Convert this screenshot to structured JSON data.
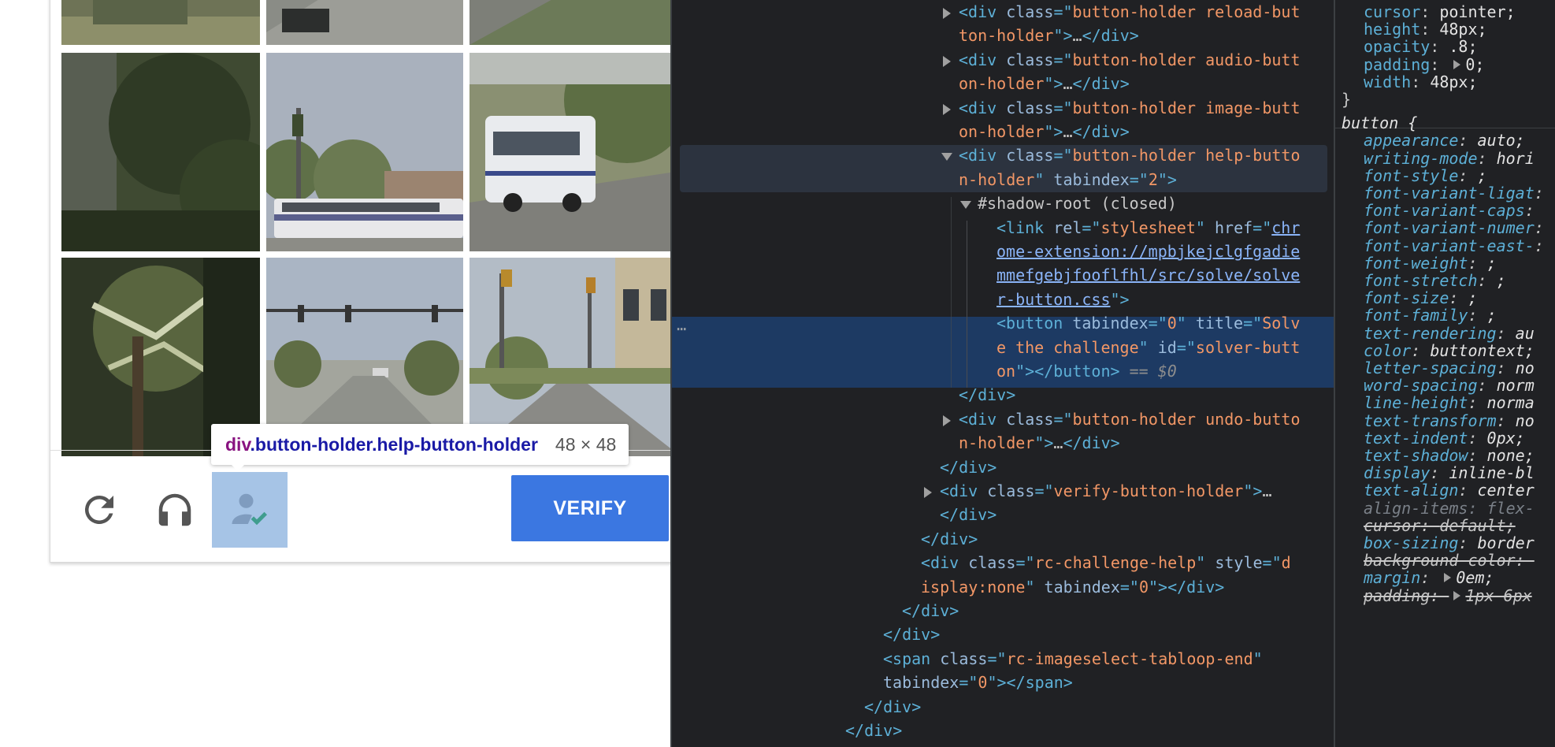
{
  "captcha": {
    "verify_label": "VERIFY",
    "tooltip": {
      "tag": "div",
      "classes": ".button-holder.help-button-holder",
      "size": "48 × 48"
    },
    "icons": {
      "reload": "reload-icon",
      "audio": "headphones-icon",
      "help": "person-check-icon"
    },
    "colors": {
      "verify_bg": "#3b77e1",
      "highlight": "#6fa0d7"
    }
  },
  "dom_tree": {
    "rows": [
      {
        "indent": 0,
        "toggle": "closed",
        "parts": [
          [
            "tag",
            "<div "
          ],
          [
            "attr",
            "class"
          ],
          [
            "tag",
            "=\""
          ],
          [
            "val",
            "button-holder reload-but"
          ]
        ]
      },
      {
        "indent": 0,
        "toggle": null,
        "parts": [
          [
            "val",
            "ton-holder"
          ],
          [
            "tag",
            "\">"
          ],
          [
            "text",
            "…"
          ],
          [
            "tag",
            "</div>"
          ]
        ]
      },
      {
        "indent": 0,
        "toggle": "closed",
        "parts": [
          [
            "tag",
            "<div "
          ],
          [
            "attr",
            "class"
          ],
          [
            "tag",
            "=\""
          ],
          [
            "val",
            "button-holder audio-butt"
          ]
        ]
      },
      {
        "indent": 0,
        "toggle": null,
        "parts": [
          [
            "val",
            "on-holder"
          ],
          [
            "tag",
            "\">"
          ],
          [
            "text",
            "…"
          ],
          [
            "tag",
            "</div>"
          ]
        ]
      },
      {
        "indent": 0,
        "toggle": "closed",
        "parts": [
          [
            "tag",
            "<div "
          ],
          [
            "attr",
            "class"
          ],
          [
            "tag",
            "=\""
          ],
          [
            "val",
            "button-holder image-butt"
          ]
        ]
      },
      {
        "indent": 0,
        "toggle": null,
        "parts": [
          [
            "val",
            "on-holder"
          ],
          [
            "tag",
            "\">"
          ],
          [
            "text",
            "…"
          ],
          [
            "tag",
            "</div>"
          ]
        ]
      },
      {
        "indent": 0,
        "toggle": "open",
        "parts": [
          [
            "tag",
            "<div "
          ],
          [
            "attr",
            "class"
          ],
          [
            "tag",
            "=\""
          ],
          [
            "val",
            "button-holder help-butto"
          ]
        ]
      },
      {
        "indent": 0,
        "toggle": null,
        "parts": [
          [
            "val",
            "n-holder"
          ],
          [
            "tag",
            "\" "
          ],
          [
            "attr",
            "tabindex"
          ],
          [
            "tag",
            "=\""
          ],
          [
            "val",
            "2"
          ],
          [
            "tag",
            "\">"
          ]
        ]
      },
      {
        "indent": 1,
        "toggle": "open",
        "parts": [
          [
            "text",
            "#shadow-root (closed)"
          ]
        ]
      },
      {
        "indent": 2,
        "toggle": null,
        "parts": [
          [
            "tag",
            "<link "
          ],
          [
            "attr",
            "rel"
          ],
          [
            "tag",
            "=\""
          ],
          [
            "val",
            "stylesheet"
          ],
          [
            "tag",
            "\" "
          ],
          [
            "attr",
            "href"
          ],
          [
            "tag",
            "=\""
          ],
          [
            "link",
            "chr"
          ]
        ]
      },
      {
        "indent": 2,
        "toggle": null,
        "parts": [
          [
            "link",
            "ome-extension://mpbjkejclgfgadie"
          ]
        ]
      },
      {
        "indent": 2,
        "toggle": null,
        "parts": [
          [
            "link",
            "mmefgebjfooflfhl/src/solve/solve"
          ]
        ]
      },
      {
        "indent": 2,
        "toggle": null,
        "parts": [
          [
            "link",
            "r-button.css"
          ],
          [
            "tag",
            "\">"
          ]
        ]
      },
      {
        "indent": 2,
        "toggle": null,
        "parts": [
          [
            "tag",
            "<button "
          ],
          [
            "attr",
            "tabindex"
          ],
          [
            "tag",
            "=\""
          ],
          [
            "val",
            "0"
          ],
          [
            "tag",
            "\" "
          ],
          [
            "attr",
            "title"
          ],
          [
            "tag",
            "=\""
          ],
          [
            "val",
            "Solv"
          ]
        ]
      },
      {
        "indent": 2,
        "toggle": null,
        "parts": [
          [
            "val",
            "e the challenge"
          ],
          [
            "tag",
            "\" "
          ],
          [
            "attr",
            "id"
          ],
          [
            "tag",
            "=\""
          ],
          [
            "val",
            "solver-butt"
          ]
        ]
      },
      {
        "indent": 2,
        "toggle": null,
        "parts": [
          [
            "val",
            "on"
          ],
          [
            "tag",
            "\"></button>"
          ],
          [
            "dim",
            " == $0"
          ]
        ]
      },
      {
        "indent": 0,
        "toggle": null,
        "parts": [
          [
            "tag",
            "</div>"
          ]
        ]
      },
      {
        "indent": 0,
        "toggle": "closed",
        "parts": [
          [
            "tag",
            "<div "
          ],
          [
            "attr",
            "class"
          ],
          [
            "tag",
            "=\""
          ],
          [
            "val",
            "button-holder undo-butto"
          ]
        ]
      },
      {
        "indent": 0,
        "toggle": null,
        "parts": [
          [
            "val",
            "n-holder"
          ],
          [
            "tag",
            "\">"
          ],
          [
            "text",
            "…"
          ],
          [
            "tag",
            "</div>"
          ]
        ]
      },
      {
        "indent": -1,
        "toggle": null,
        "parts": [
          [
            "tag",
            "</div>"
          ]
        ]
      },
      {
        "indent": -1,
        "toggle": "closed",
        "parts": [
          [
            "tag",
            "<div "
          ],
          [
            "attr",
            "class"
          ],
          [
            "tag",
            "=\""
          ],
          [
            "val",
            "verify-button-holder"
          ],
          [
            "tag",
            "\">"
          ],
          [
            "text",
            "…"
          ]
        ]
      },
      {
        "indent": -1,
        "toggle": null,
        "parts": [
          [
            "tag",
            "</div>"
          ]
        ]
      },
      {
        "indent": -2,
        "toggle": null,
        "parts": [
          [
            "tag",
            "</div>"
          ]
        ]
      },
      {
        "indent": -2,
        "toggle": null,
        "parts": [
          [
            "tag",
            "<div "
          ],
          [
            "attr",
            "class"
          ],
          [
            "tag",
            "=\""
          ],
          [
            "val",
            "rc-challenge-help"
          ],
          [
            "tag",
            "\" "
          ],
          [
            "attr",
            "style"
          ],
          [
            "tag",
            "=\""
          ],
          [
            "val",
            "d"
          ]
        ]
      },
      {
        "indent": -2,
        "toggle": null,
        "parts": [
          [
            "val",
            "isplay:none"
          ],
          [
            "tag",
            "\" "
          ],
          [
            "attr",
            "tabindex"
          ],
          [
            "tag",
            "=\""
          ],
          [
            "val",
            "0"
          ],
          [
            "tag",
            "\"></div>"
          ]
        ]
      },
      {
        "indent": -3,
        "toggle": null,
        "parts": [
          [
            "tag",
            "</div>"
          ]
        ]
      },
      {
        "indent": -4,
        "toggle": null,
        "parts": [
          [
            "tag",
            "</div>"
          ]
        ]
      },
      {
        "indent": -4,
        "toggle": null,
        "parts": [
          [
            "tag",
            "<span "
          ],
          [
            "attr",
            "class"
          ],
          [
            "tag",
            "=\""
          ],
          [
            "val",
            "rc-imageselect-tabloop-end"
          ],
          [
            "tag",
            "\""
          ]
        ]
      },
      {
        "indent": -4,
        "toggle": null,
        "parts": [
          [
            "attr",
            "tabindex"
          ],
          [
            "tag",
            "=\""
          ],
          [
            "val",
            "0"
          ],
          [
            "tag",
            "\"></span>"
          ]
        ]
      },
      {
        "indent": -5,
        "toggle": null,
        "parts": [
          [
            "tag",
            "</div>"
          ]
        ]
      },
      {
        "indent": -6,
        "toggle": null,
        "parts": [
          [
            "tag",
            "</div>"
          ]
        ]
      }
    ]
  },
  "styles": {
    "rows": [
      {
        "kind": "decl",
        "prop": "cursor",
        "value": "pointer;"
      },
      {
        "kind": "decl",
        "prop": "height",
        "value": "48px;"
      },
      {
        "kind": "decl",
        "prop": "opacity",
        "value": ".8;"
      },
      {
        "kind": "decl",
        "prop": "padding",
        "value": "0;",
        "expand": true
      },
      {
        "kind": "decl",
        "prop": "width",
        "value": "48px;"
      },
      {
        "kind": "brace",
        "text": "}"
      },
      {
        "kind": "selector",
        "text": "button {"
      },
      {
        "kind": "ua",
        "prop": "appearance",
        "value": "auto;"
      },
      {
        "kind": "ua",
        "prop": "writing-mode",
        "value": "hori"
      },
      {
        "kind": "ua",
        "prop": "font-style",
        "value": ";"
      },
      {
        "kind": "ua",
        "prop": "font-variant-ligat",
        "value": ""
      },
      {
        "kind": "ua",
        "prop": "font-variant-caps",
        "value": ""
      },
      {
        "kind": "ua",
        "prop": "font-variant-numer",
        "value": ""
      },
      {
        "kind": "ua",
        "prop": "font-variant-east-",
        "value": ""
      },
      {
        "kind": "ua",
        "prop": "font-weight",
        "value": ";"
      },
      {
        "kind": "ua",
        "prop": "font-stretch",
        "value": ";"
      },
      {
        "kind": "ua",
        "prop": "font-size",
        "value": ";"
      },
      {
        "kind": "ua",
        "prop": "font-family",
        "value": ";"
      },
      {
        "kind": "ua",
        "prop": "text-rendering",
        "value": "au"
      },
      {
        "kind": "ua",
        "prop": "color",
        "value": "buttontext;"
      },
      {
        "kind": "ua",
        "prop": "letter-spacing",
        "value": "no"
      },
      {
        "kind": "ua",
        "prop": "word-spacing",
        "value": "norm"
      },
      {
        "kind": "ua",
        "prop": "line-height",
        "value": "norma"
      },
      {
        "kind": "ua",
        "prop": "text-transform",
        "value": "no"
      },
      {
        "kind": "ua",
        "prop": "text-indent",
        "value": "0px;"
      },
      {
        "kind": "ua",
        "prop": "text-shadow",
        "value": "none;"
      },
      {
        "kind": "ua",
        "prop": "display",
        "value": "inline-bl"
      },
      {
        "kind": "ua",
        "prop": "text-align",
        "value": "center"
      },
      {
        "kind": "inherited",
        "prop": "align-items",
        "value": "flex-"
      },
      {
        "kind": "struck",
        "prop": "cursor",
        "value": "default;"
      },
      {
        "kind": "ua",
        "prop": "box-sizing",
        "value": "border"
      },
      {
        "kind": "struck",
        "prop": "background-color",
        "value": ""
      },
      {
        "kind": "ua",
        "prop": "margin",
        "value": "0em;",
        "expand": true
      },
      {
        "kind": "struck",
        "prop": "padding",
        "value": "1px 6px",
        "expand": true
      }
    ]
  }
}
